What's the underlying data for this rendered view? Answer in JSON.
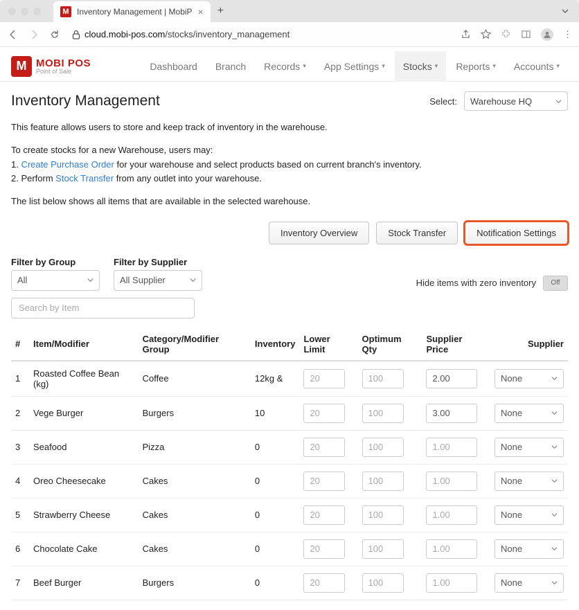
{
  "browser": {
    "tab_title": "Inventory Management | MobiP",
    "url_host": "cloud.mobi-pos.com",
    "url_path": "/stocks/inventory_management"
  },
  "logo": {
    "mark": "M",
    "top": "MOBI POS",
    "bot": "Point of Sale"
  },
  "nav": {
    "items": [
      "Dashboard",
      "Branch",
      "Records",
      "App Settings",
      "Stocks",
      "Reports",
      "Accounts"
    ],
    "caret_indices": [
      2,
      3,
      4,
      5,
      6
    ],
    "active_index": 4
  },
  "page": {
    "title": "Inventory Management",
    "select_label": "Select:",
    "select_value": "Warehouse HQ",
    "intro": "This feature allows users to store and keep track of inventory in the warehouse.",
    "howto_lead": "To create stocks for a new Warehouse, users may:",
    "howto_1_pre": "1. ",
    "howto_1_link": "Create Purchase Order",
    "howto_1_post": " for your warehouse and select products based on current branch's inventory.",
    "howto_2_pre": "2. Perform ",
    "howto_2_link": "Stock Transfer",
    "howto_2_post": " from any outlet into your warehouse.",
    "summary": "The list below shows all items that are available in the selected warehouse."
  },
  "actions": {
    "overview": "Inventory Overview",
    "transfer": "Stock Transfer",
    "notify": "Notification Settings"
  },
  "filters": {
    "group_label": "Filter by Group",
    "group_value": "All",
    "supplier_label": "Filter by Supplier",
    "supplier_value": "All Supplier",
    "hide_zero_label": "Hide items with zero inventory",
    "hide_zero_state": "Off",
    "search_placeholder": "Search by Item"
  },
  "table": {
    "headers": {
      "num": "#",
      "item": "Item/Modifier",
      "category": "Category/Modifier Group",
      "inventory": "Inventory",
      "lower": "Lower Limit",
      "optimum": "Optimum Qty",
      "price": "Supplier Price",
      "supplier": "Supplier"
    },
    "placeholders": {
      "lower": "20",
      "optimum": "100",
      "price": "1.00",
      "supplier": "None"
    },
    "rows": [
      {
        "n": "1",
        "item": "Roasted Coffee Bean (kg)",
        "cat": "Coffee",
        "inv": "12kg &",
        "lower": "",
        "opt": "",
        "price": "2.00",
        "supplier": "None"
      },
      {
        "n": "2",
        "item": "Vege Burger",
        "cat": "Burgers",
        "inv": "10",
        "lower": "",
        "opt": "",
        "price": "3.00",
        "supplier": "None"
      },
      {
        "n": "3",
        "item": "Seafood",
        "cat": "Pizza",
        "inv": "0",
        "lower": "",
        "opt": "",
        "price": "",
        "supplier": "None"
      },
      {
        "n": "4",
        "item": "Oreo Cheesecake",
        "cat": "Cakes",
        "inv": "0",
        "lower": "",
        "opt": "",
        "price": "",
        "supplier": "None"
      },
      {
        "n": "5",
        "item": "Strawberry Cheese",
        "cat": "Cakes",
        "inv": "0",
        "lower": "",
        "opt": "",
        "price": "",
        "supplier": "None"
      },
      {
        "n": "6",
        "item": "Chocolate Cake",
        "cat": "Cakes",
        "inv": "0",
        "lower": "",
        "opt": "",
        "price": "",
        "supplier": "None"
      },
      {
        "n": "7",
        "item": "Beef Burger",
        "cat": "Burgers",
        "inv": "0",
        "lower": "",
        "opt": "",
        "price": "",
        "supplier": "None"
      }
    ]
  }
}
